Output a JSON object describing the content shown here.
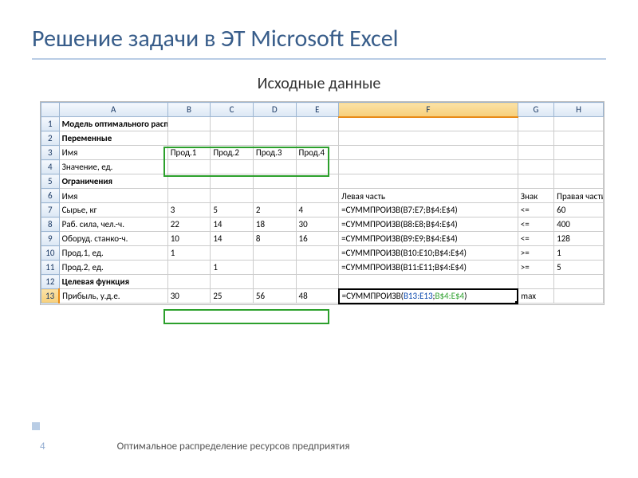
{
  "slide": {
    "title": "Решение задачи в ЭТ Microsoft Excel",
    "subtitle": "Исходные данные",
    "footer_text": "Оптимальное распределение ресурсов  предприятия",
    "page_number": "4"
  },
  "columns": [
    "A",
    "B",
    "C",
    "D",
    "E",
    "F",
    "G",
    "H"
  ],
  "rows": [
    {
      "n": "1",
      "cells": [
        "Модель оптимального распределения ресурсов",
        "",
        "",
        "",
        "",
        "",
        "",
        ""
      ],
      "bold": true
    },
    {
      "n": "2",
      "cells": [
        "Переменные",
        "",
        "",
        "",
        "",
        "",
        "",
        ""
      ],
      "bold": true
    },
    {
      "n": "3",
      "cells": [
        "Имя",
        "Прод.1",
        "Прод.2",
        "Прод.3",
        "Прод.4",
        "",
        "",
        ""
      ]
    },
    {
      "n": "4",
      "cells": [
        "Значение, ед.",
        "",
        "",
        "",
        "",
        "",
        "",
        ""
      ]
    },
    {
      "n": "5",
      "cells": [
        "Ограничения",
        "",
        "",
        "",
        "",
        "",
        "",
        ""
      ],
      "bold": true
    },
    {
      "n": "6",
      "cells": [
        "Имя",
        "",
        "",
        "",
        "",
        "Левая часть",
        "Знак",
        "Правая часть"
      ],
      "tall": true
    },
    {
      "n": "7",
      "cells": [
        "Сырье, кг",
        "3",
        "5",
        "2",
        "4",
        "=СУММПРОИЗВ(B7:E7;B$4:E$4)",
        "<=",
        "60"
      ]
    },
    {
      "n": "8",
      "cells": [
        "Раб. сила, чел.-ч.",
        "22",
        "14",
        "18",
        "30",
        "=СУММПРОИЗВ(B8:E8;B$4:E$4)",
        "<=",
        "400"
      ]
    },
    {
      "n": "9",
      "cells": [
        "Оборуд. станко-ч.",
        "10",
        "14",
        "8",
        "16",
        "=СУММПРОИЗВ(B9:E9;B$4:E$4)",
        "<=",
        "128"
      ]
    },
    {
      "n": "10",
      "cells": [
        "Прод.1, ед.",
        "1",
        "",
        "",
        "",
        "=СУММПРОИЗВ(B10:E10;B$4:E$4)",
        ">=",
        "1"
      ]
    },
    {
      "n": "11",
      "cells": [
        "Прод.2, ед.",
        "",
        "1",
        "",
        "",
        "=СУММПРОИЗВ(B11:E11;B$4:E$4)",
        ">=",
        "5"
      ]
    },
    {
      "n": "12",
      "cells": [
        "Целевая функция",
        "",
        "",
        "",
        "",
        "",
        "",
        ""
      ],
      "bold": true
    },
    {
      "n": "13",
      "cells": [
        "Прибыль, у.д.е.",
        "30",
        "25",
        "56",
        "48",
        "",
        "max",
        ""
      ],
      "selected": true
    }
  ],
  "sel_formula": {
    "prefix": "=СУММПРОИЗВ(",
    "blue": "B13:E13",
    "sep": ";",
    "green": "B$4:E$4",
    "suffix": ")"
  }
}
